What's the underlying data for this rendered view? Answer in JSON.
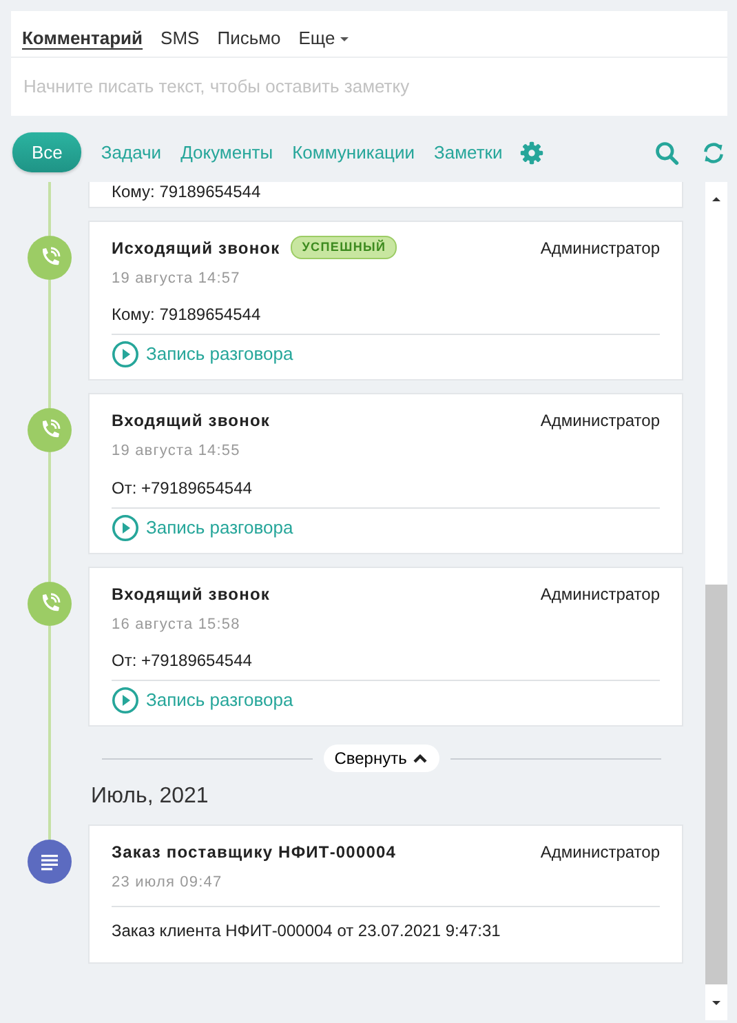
{
  "compose": {
    "tabs": [
      {
        "label": "Комментарий",
        "selected": true,
        "dropdown": false
      },
      {
        "label": "SMS",
        "selected": false,
        "dropdown": false
      },
      {
        "label": "Письмо",
        "selected": false,
        "dropdown": false
      },
      {
        "label": "Еще",
        "selected": false,
        "dropdown": true
      }
    ],
    "placeholder": "Начните писать текст, чтобы оставить заметку"
  },
  "filters": [
    {
      "label": "Все",
      "selected": true
    },
    {
      "label": "Задачи",
      "selected": false
    },
    {
      "label": "Документы",
      "selected": false
    },
    {
      "label": "Коммуникации",
      "selected": false
    },
    {
      "label": "Заметки",
      "selected": false
    }
  ],
  "timeline": [
    {
      "kind": "partial",
      "body": "Кому: 79189654544"
    },
    {
      "kind": "call",
      "color": "#9ccc65",
      "title": "Исходящий звонок",
      "badge": "УСПЕШНЫЙ",
      "author": "Администратор",
      "date": "19 августа 14:57",
      "body": "Кому: 79189654544",
      "link": "Запись разговора"
    },
    {
      "kind": "call",
      "color": "#9ccc65",
      "title": "Входящий звонок",
      "author": "Администратор",
      "date": "19 августа 14:55",
      "body": "От: +79189654544",
      "link": "Запись разговора"
    },
    {
      "kind": "call",
      "color": "#9ccc65",
      "title": "Входящий звонок",
      "author": "Администратор",
      "date": "16 августа 15:58",
      "body": "От: +79189654544",
      "link": "Запись разговора"
    },
    {
      "kind": "collapse",
      "label": "Свернуть"
    },
    {
      "kind": "month",
      "label": "Июль, 2021"
    },
    {
      "kind": "document",
      "color": "#5c6bc0",
      "title": "Заказ поставщику НФИТ-000004",
      "author": "Администратор",
      "date": "23 июля 09:47",
      "body": "Заказ клиента НФИТ-000004 от 23.07.2021 9:47:31"
    }
  ]
}
